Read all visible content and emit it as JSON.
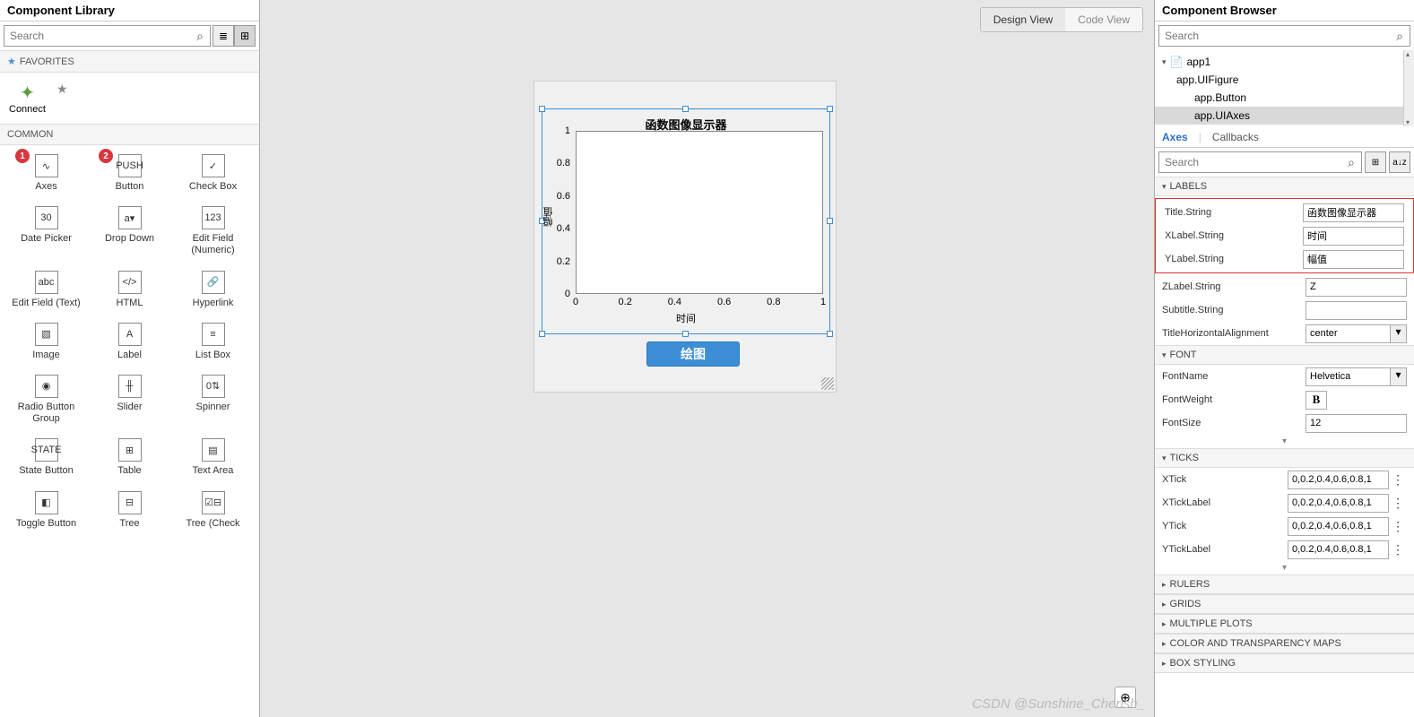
{
  "left": {
    "title": "Component Library",
    "search_ph": "Search",
    "favorites_hdr": "FAVORITES",
    "common_hdr": "COMMON",
    "connect_label": "Connect",
    "badges": [
      "1",
      "2"
    ],
    "components": [
      {
        "label": "Axes",
        "icon": "∿"
      },
      {
        "label": "Button",
        "icon": "PUSH"
      },
      {
        "label": "Check Box",
        "icon": "✓"
      },
      {
        "label": "Date Picker",
        "icon": "30"
      },
      {
        "label": "Drop Down",
        "icon": "a▾"
      },
      {
        "label": "Edit Field (Numeric)",
        "icon": "123"
      },
      {
        "label": "Edit Field (Text)",
        "icon": "abc"
      },
      {
        "label": "HTML",
        "icon": "</>"
      },
      {
        "label": "Hyperlink",
        "icon": "🔗"
      },
      {
        "label": "Image",
        "icon": "▧"
      },
      {
        "label": "Label",
        "icon": "A"
      },
      {
        "label": "List Box",
        "icon": "≡"
      },
      {
        "label": "Radio Button Group",
        "icon": "◉"
      },
      {
        "label": "Slider",
        "icon": "╫"
      },
      {
        "label": "Spinner",
        "icon": "0⇅"
      },
      {
        "label": "State Button",
        "icon": "STATE"
      },
      {
        "label": "Table",
        "icon": "⊞"
      },
      {
        "label": "Text Area",
        "icon": "▤"
      },
      {
        "label": "Toggle Button",
        "icon": "◧"
      },
      {
        "label": "Tree",
        "icon": "⊟"
      },
      {
        "label": "Tree (Check",
        "icon": "☑⊟"
      }
    ]
  },
  "center": {
    "design_tab": "Design View",
    "code_tab": "Code View",
    "button_label": "绘图",
    "watermark": "CSDN @Sunshine_Cherish_"
  },
  "chart_data": {
    "type": "line",
    "title": "函数图像显示器",
    "xlabel": "时间",
    "ylabel": "幅值",
    "xlim": [
      0,
      1
    ],
    "ylim": [
      0,
      1
    ],
    "xticks": [
      0,
      0.2,
      0.4,
      0.6,
      0.8,
      1
    ],
    "yticks": [
      0,
      0.2,
      0.4,
      0.6,
      0.8,
      1
    ],
    "series": []
  },
  "right": {
    "title": "Component Browser",
    "search_ph": "Search",
    "tree": {
      "root": "app1",
      "figure": "app.UIFigure",
      "button": "app.Button",
      "axes": "app.UIAxes"
    },
    "tabs": {
      "axes": "Axes",
      "callbacks": "Callbacks"
    },
    "insp_search_ph": "Search",
    "sections": {
      "labels": "LABELS",
      "font": "FONT",
      "ticks": "TICKS",
      "rulers": "RULERS",
      "grids": "GRIDS",
      "multiple": "MULTIPLE PLOTS",
      "color": "COLOR AND TRANSPARENCY MAPS",
      "box": "BOX STYLING"
    },
    "labels": {
      "title_k": "Title.String",
      "title_v": "函数图像显示器",
      "xlabel_k": "XLabel.String",
      "xlabel_v": "时间",
      "ylabel_k": "YLabel.String",
      "ylabel_v": "幅值",
      "zlabel_k": "ZLabel.String",
      "zlabel_v": "Z",
      "subtitle_k": "Subtitle.String",
      "subtitle_v": "",
      "tha_k": "TitleHorizontalAlignment",
      "tha_v": "center"
    },
    "font": {
      "name_k": "FontName",
      "name_v": "Helvetica",
      "weight_k": "FontWeight",
      "size_k": "FontSize",
      "size_v": "12"
    },
    "ticks": {
      "xtick_k": "XTick",
      "xtick_v": "0,0.2,0.4,0.6,0.8,1",
      "xticklbl_k": "XTickLabel",
      "xticklbl_v": "0,0.2,0.4,0.6,0.8,1",
      "ytick_k": "YTick",
      "ytick_v": "0,0.2,0.4,0.6,0.8,1",
      "yticklbl_k": "YTickLabel",
      "yticklbl_v": "0,0.2,0.4,0.6,0.8,1"
    }
  }
}
